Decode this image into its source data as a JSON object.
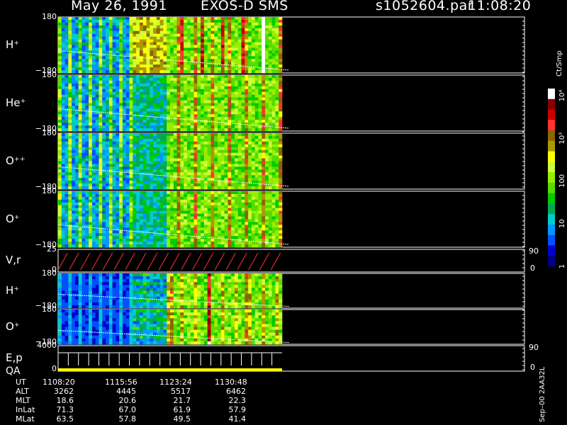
{
  "header": {
    "date": "May 26, 1991",
    "instrument": "EXOS-D SMS",
    "file_name": "s1052604.par",
    "time": "11:08:20"
  },
  "colorbar": {
    "unit_label": "Ct/Smp",
    "tick_labels": [
      "1",
      "10",
      "100",
      "10³",
      "10⁴"
    ],
    "colors": [
      "#000080",
      "#0000cc",
      "#0050ff",
      "#0099ff",
      "#00cccc",
      "#00aa55",
      "#00cc00",
      "#55dd00",
      "#99ee00",
      "#ccff33",
      "#ffff00",
      "#aa9900",
      "#886600",
      "#ff3333",
      "#cc0000",
      "#880000",
      "#ffffff"
    ]
  },
  "panels": [
    {
      "label": "H⁺",
      "ytop": "180",
      "ybot": "−180"
    },
    {
      "label": "He⁺",
      "ytop": "180",
      "ybot": "−180"
    },
    {
      "label": "O⁺⁺",
      "ytop": "180",
      "ybot": "−180"
    },
    {
      "label": "O⁺",
      "ytop": "180",
      "ybot": "−180"
    },
    {
      "label": "V,r",
      "ytop": "25",
      "ybot": "0",
      "rtop": "90",
      "rbot": "0"
    },
    {
      "label": "H⁺",
      "ytop": "180",
      "ybot": "−180"
    },
    {
      "label": "O⁺",
      "ytop": "180",
      "ybot": "−180"
    },
    {
      "label": "E,p",
      "ytop": "4000",
      "ybot": "0",
      "rtop": "90",
      "rbot": "0",
      "label2": "QA"
    }
  ],
  "side_note": "Sep–00 2AA32L",
  "chart_data": {
    "type": "heatmap",
    "title": "May 26, 1991   EXOS-D SMS",
    "x": [
      "1108:20",
      "1115:56",
      "1123:24",
      "1130:48"
    ],
    "ephemeris": {
      "rows": [
        {
          "name": "UT",
          "values": [
            "1108:20",
            "1115:56",
            "1123:24",
            "1130:48"
          ]
        },
        {
          "name": "ALT",
          "values": [
            "3262",
            "4445",
            "5517",
            "6462"
          ]
        },
        {
          "name": "MLT",
          "values": [
            "18.6",
            "20.6",
            "21.7",
            "22.3"
          ]
        },
        {
          "name": "InLat",
          "values": [
            "71.3",
            "67.0",
            "61.9",
            "57.9"
          ]
        },
        {
          "name": "MLat",
          "values": [
            "63.5",
            "57.8",
            "49.5",
            "41.4"
          ]
        }
      ]
    }
  }
}
